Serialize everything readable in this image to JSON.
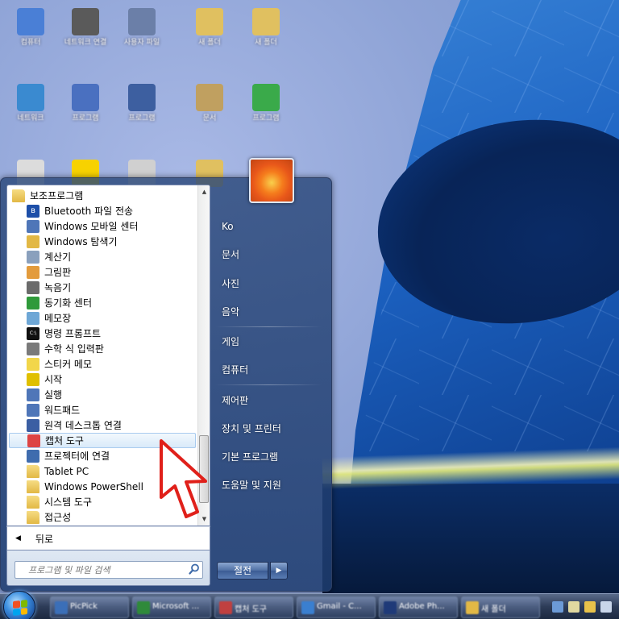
{
  "desktop": {
    "icons": [
      {
        "name": "icon-computer",
        "label": "컴퓨터"
      },
      {
        "name": "icon-network",
        "label": "네트워크 연결"
      },
      {
        "name": "icon-user-files",
        "label": "사용자 파일"
      },
      {
        "name": "icon-folder-1",
        "label": "새 폴더"
      },
      {
        "name": "icon-folder-2",
        "label": "새 폴더"
      },
      {
        "name": "icon-network-2",
        "label": "네트워크"
      },
      {
        "name": "icon-app-1",
        "label": "프로그램"
      },
      {
        "name": "icon-app-2",
        "label": "프로그램"
      },
      {
        "name": "icon-file-1",
        "label": "문서"
      },
      {
        "name": "icon-app-3",
        "label": "프로그램"
      },
      {
        "name": "icon-recycle-bin",
        "label": ""
      },
      {
        "name": "icon-kakaotalk",
        "label": ""
      },
      {
        "name": "icon-app-4",
        "label": ""
      },
      {
        "name": "icon-file-2",
        "label": ""
      }
    ]
  },
  "start_menu": {
    "programs": [
      {
        "label": "보조프로그램",
        "icon": "folder-open-icon",
        "folder": true,
        "indent": 0
      },
      {
        "label": "Bluetooth 파일 전송",
        "icon": "bluetooth-icon",
        "indent": 1
      },
      {
        "label": "Windows 모바일 센터",
        "icon": "mobility-center-icon",
        "indent": 1
      },
      {
        "label": "Windows 탐색기",
        "icon": "explorer-icon",
        "indent": 1
      },
      {
        "label": "계산기",
        "icon": "calculator-icon",
        "indent": 1
      },
      {
        "label": "그림판",
        "icon": "paint-icon",
        "indent": 1
      },
      {
        "label": "녹음기",
        "icon": "sound-recorder-icon",
        "indent": 1
      },
      {
        "label": "동기화 센터",
        "icon": "sync-center-icon",
        "indent": 1
      },
      {
        "label": "메모장",
        "icon": "notepad-icon",
        "indent": 1
      },
      {
        "label": "명령 프롬프트",
        "icon": "command-prompt-icon",
        "indent": 1
      },
      {
        "label": "수학 식 입력판",
        "icon": "math-input-icon",
        "indent": 1
      },
      {
        "label": "스티커 메모",
        "icon": "sticky-notes-icon",
        "indent": 1
      },
      {
        "label": "시작",
        "icon": "getting-started-icon",
        "indent": 1
      },
      {
        "label": "실행",
        "icon": "run-icon",
        "indent": 1
      },
      {
        "label": "워드패드",
        "icon": "wordpad-icon",
        "indent": 1
      },
      {
        "label": "원격 데스크톱 연결",
        "icon": "remote-desktop-icon",
        "indent": 1
      },
      {
        "label": "캡처 도구",
        "icon": "snipping-tool-icon",
        "indent": 1,
        "highlighted": true
      },
      {
        "label": "프로젝터에 연결",
        "icon": "projector-icon",
        "indent": 1
      },
      {
        "label": "Tablet PC",
        "icon": "folder-icon",
        "folder": true,
        "indent": 1
      },
      {
        "label": "Windows PowerShell",
        "icon": "folder-icon",
        "folder": true,
        "indent": 1
      },
      {
        "label": "시스템 도구",
        "icon": "folder-icon",
        "folder": true,
        "indent": 1
      },
      {
        "label": "접근성",
        "icon": "folder-icon",
        "folder": true,
        "indent": 1
      }
    ],
    "back_label": "뒤로",
    "search_placeholder": "프로그램 및 파일 검색",
    "right_items": [
      {
        "label": "Ko",
        "name": "right-item-user"
      },
      {
        "label": "문서",
        "name": "right-item-documents"
      },
      {
        "label": "사진",
        "name": "right-item-pictures"
      },
      {
        "label": "음악",
        "name": "right-item-music"
      },
      {
        "label": "게임",
        "name": "right-item-games"
      },
      {
        "label": "컴퓨터",
        "name": "right-item-computer"
      },
      {
        "label": "제어판",
        "name": "right-item-control-panel"
      },
      {
        "label": "장치 및 프린터",
        "name": "right-item-devices-printers"
      },
      {
        "label": "기본 프로그램",
        "name": "right-item-default-programs"
      },
      {
        "label": "도움말 및 지원",
        "name": "right-item-help-support"
      }
    ],
    "shutdown_label": "절전",
    "shutdown_arrow": "▶"
  },
  "taskbar": {
    "buttons": [
      {
        "label": "PicPick",
        "color": "#3b6fb8"
      },
      {
        "label": "Microsoft ...",
        "color": "#2f8a3a"
      },
      {
        "label": "캡처 도구",
        "color": "#c04040"
      },
      {
        "label": "Gmail - C...",
        "color": "#3a7fd0"
      },
      {
        "label": "Adobe Ph...",
        "color": "#1f3a78"
      },
      {
        "label": "새 폴더",
        "color": "#e2b845"
      }
    ]
  },
  "colors": {
    "highlight_fill": "#d9eaf9",
    "highlight_border": "#a8cbef",
    "arrow_red": "#e0201a"
  }
}
